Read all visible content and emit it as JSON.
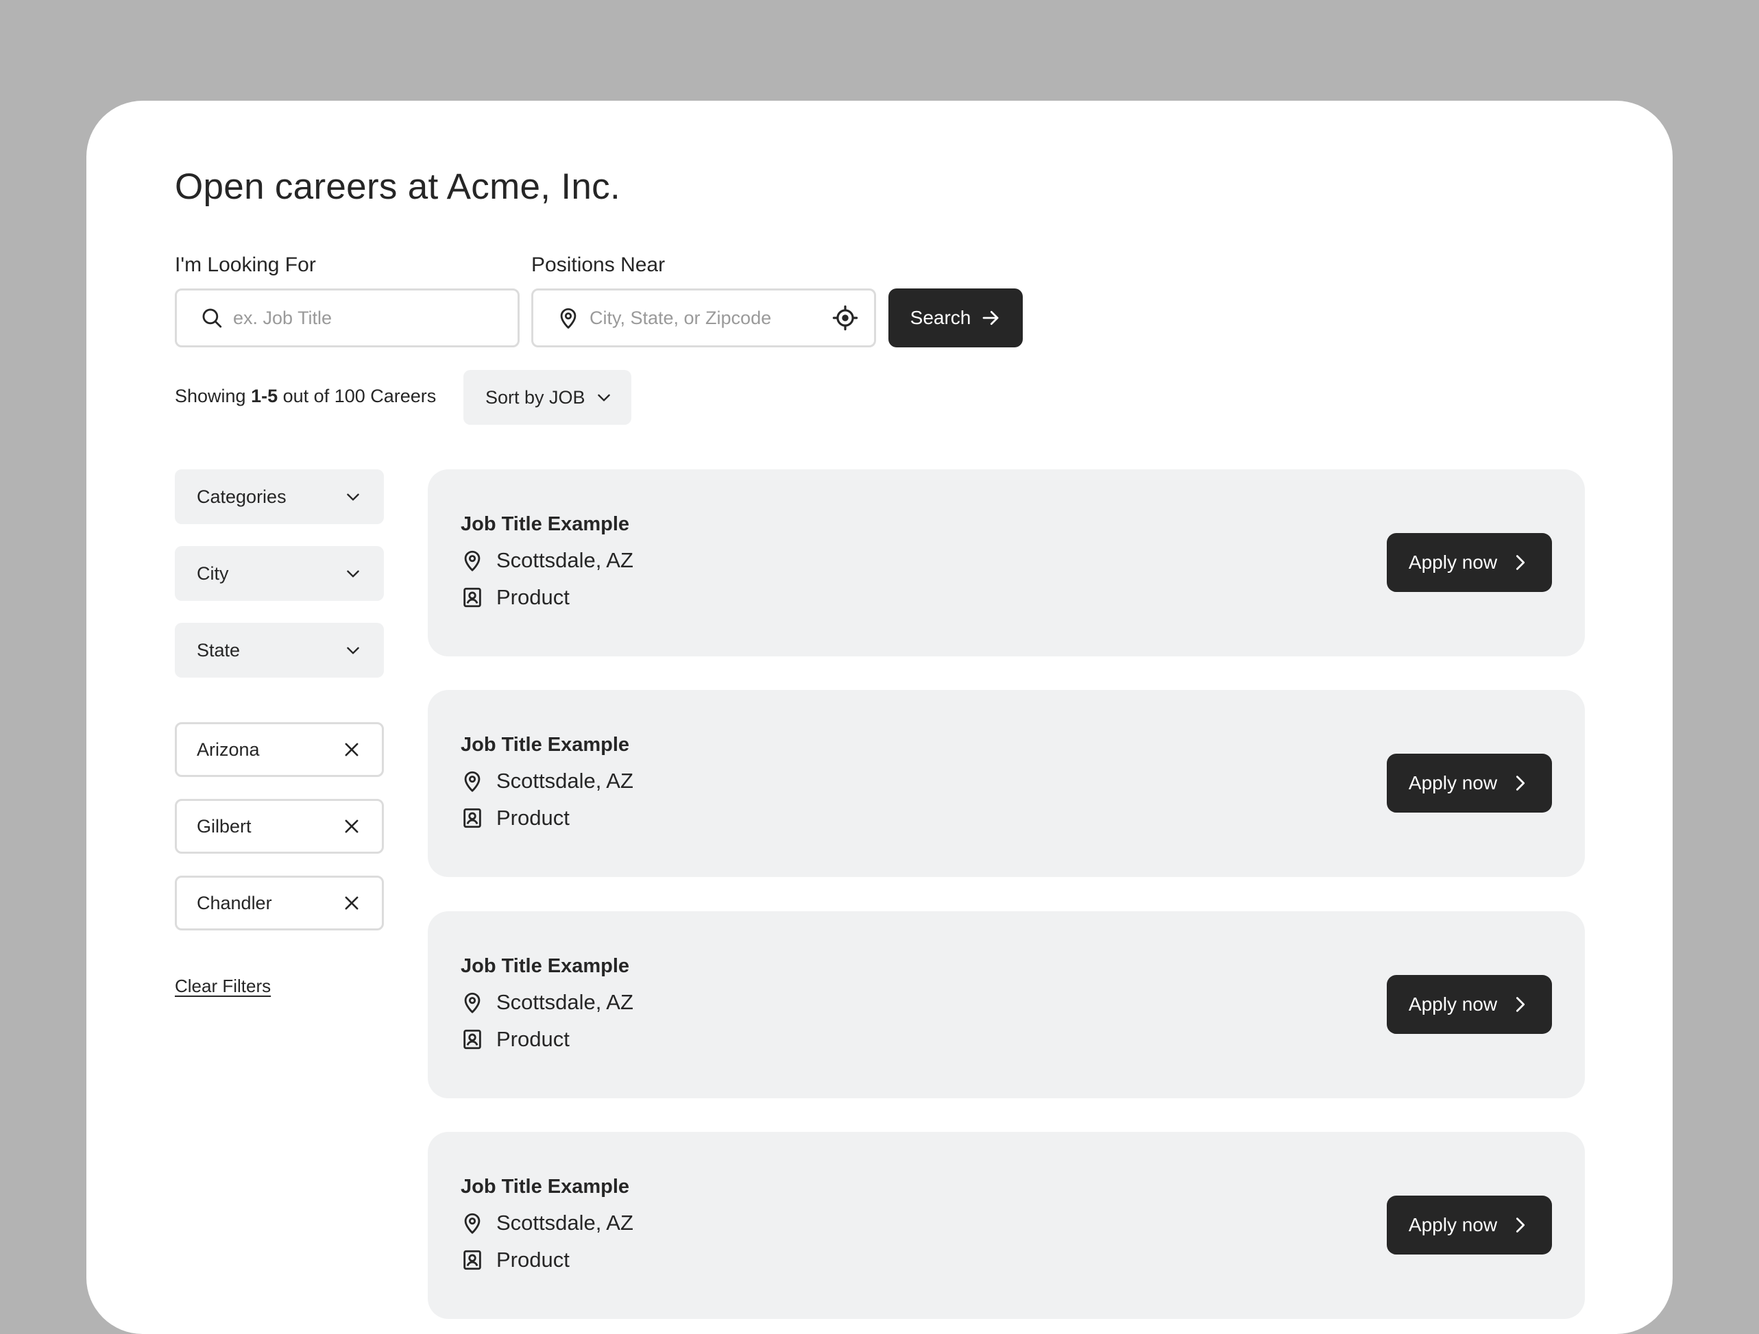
{
  "page": {
    "title": "Open careers at Acme, Inc."
  },
  "search": {
    "keyword_label": "I'm Looking For",
    "keyword_placeholder": "ex. Job Title",
    "keyword_value": "",
    "location_label": "Positions Near",
    "location_placeholder": "City, State, or Zipcode",
    "location_value": "",
    "button_label": "Search"
  },
  "results": {
    "showing_prefix": "Showing",
    "range": "1-5",
    "suffix": "out of 100 Careers"
  },
  "sort": {
    "label": "Sort by JOB"
  },
  "filters": {
    "dropdowns": [
      {
        "label": "Categories"
      },
      {
        "label": "City"
      },
      {
        "label": "State"
      }
    ],
    "chips": [
      {
        "label": "Arizona"
      },
      {
        "label": "Gilbert"
      },
      {
        "label": "Chandler"
      }
    ],
    "clear_label": "Clear Filters"
  },
  "jobs": [
    {
      "title": "Job Title Example",
      "location": "Scottsdale, AZ",
      "department": "Product",
      "apply_label": "Apply now"
    },
    {
      "title": "Job Title Example",
      "location": "Scottsdale, AZ",
      "department": "Product",
      "apply_label": "Apply now"
    },
    {
      "title": "Job Title Example",
      "location": "Scottsdale, AZ",
      "department": "Product",
      "apply_label": "Apply now"
    },
    {
      "title": "Job Title Example",
      "location": "Scottsdale, AZ",
      "department": "Product",
      "apply_label": "Apply now"
    }
  ],
  "icons": {
    "search": "search-icon",
    "location_pin": "map-pin-icon",
    "crosshair": "crosshair-icon",
    "arrow_right": "arrow-right-icon",
    "chevron_down": "chevron-down-icon",
    "close": "close-icon",
    "department": "id-badge-icon",
    "chevron_right": "chevron-right-icon"
  },
  "colors": {
    "background": "#b3b3b3",
    "panel": "#ffffff",
    "card": "#f0f1f2",
    "primary_button": "#262626",
    "text": "#262626",
    "placeholder": "#9a9a9a",
    "border": "#dcdcdc"
  }
}
